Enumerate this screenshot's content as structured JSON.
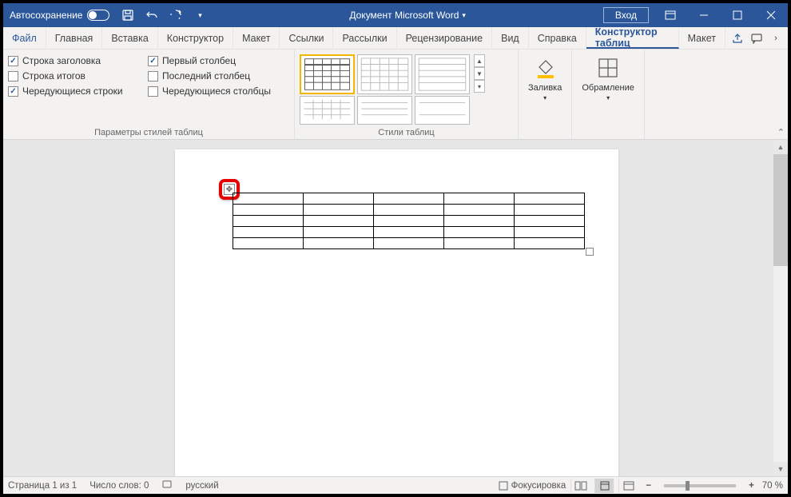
{
  "titlebar": {
    "autosave_label": "Автосохранение",
    "document_title": "Документ Microsoft Word",
    "login_label": "Вход"
  },
  "tabs": {
    "file": "Файл",
    "home": "Главная",
    "insert": "Вставка",
    "design": "Конструктор",
    "layout": "Макет",
    "references": "Ссылки",
    "mailings": "Рассылки",
    "review": "Рецензирование",
    "view": "Вид",
    "help": "Справка",
    "table_design": "Конструктор таблиц",
    "table_layout": "Макет"
  },
  "ribbon": {
    "style_options": {
      "header_row": "Строка заголовка",
      "total_row": "Строка итогов",
      "banded_rows": "Чередующиеся строки",
      "first_col": "Первый столбец",
      "last_col": "Последний столбец",
      "banded_cols": "Чередующиеся столбцы",
      "group_label": "Параметры стилей таблиц"
    },
    "table_styles_label": "Стили таблиц",
    "shading_label": "Заливка",
    "borders_label": "Обрамление"
  },
  "statusbar": {
    "page_info": "Страница 1 из 1",
    "word_count": "Число слов: 0",
    "language": "русский",
    "focus_label": "Фокусировка",
    "zoom_value": "70 %"
  }
}
